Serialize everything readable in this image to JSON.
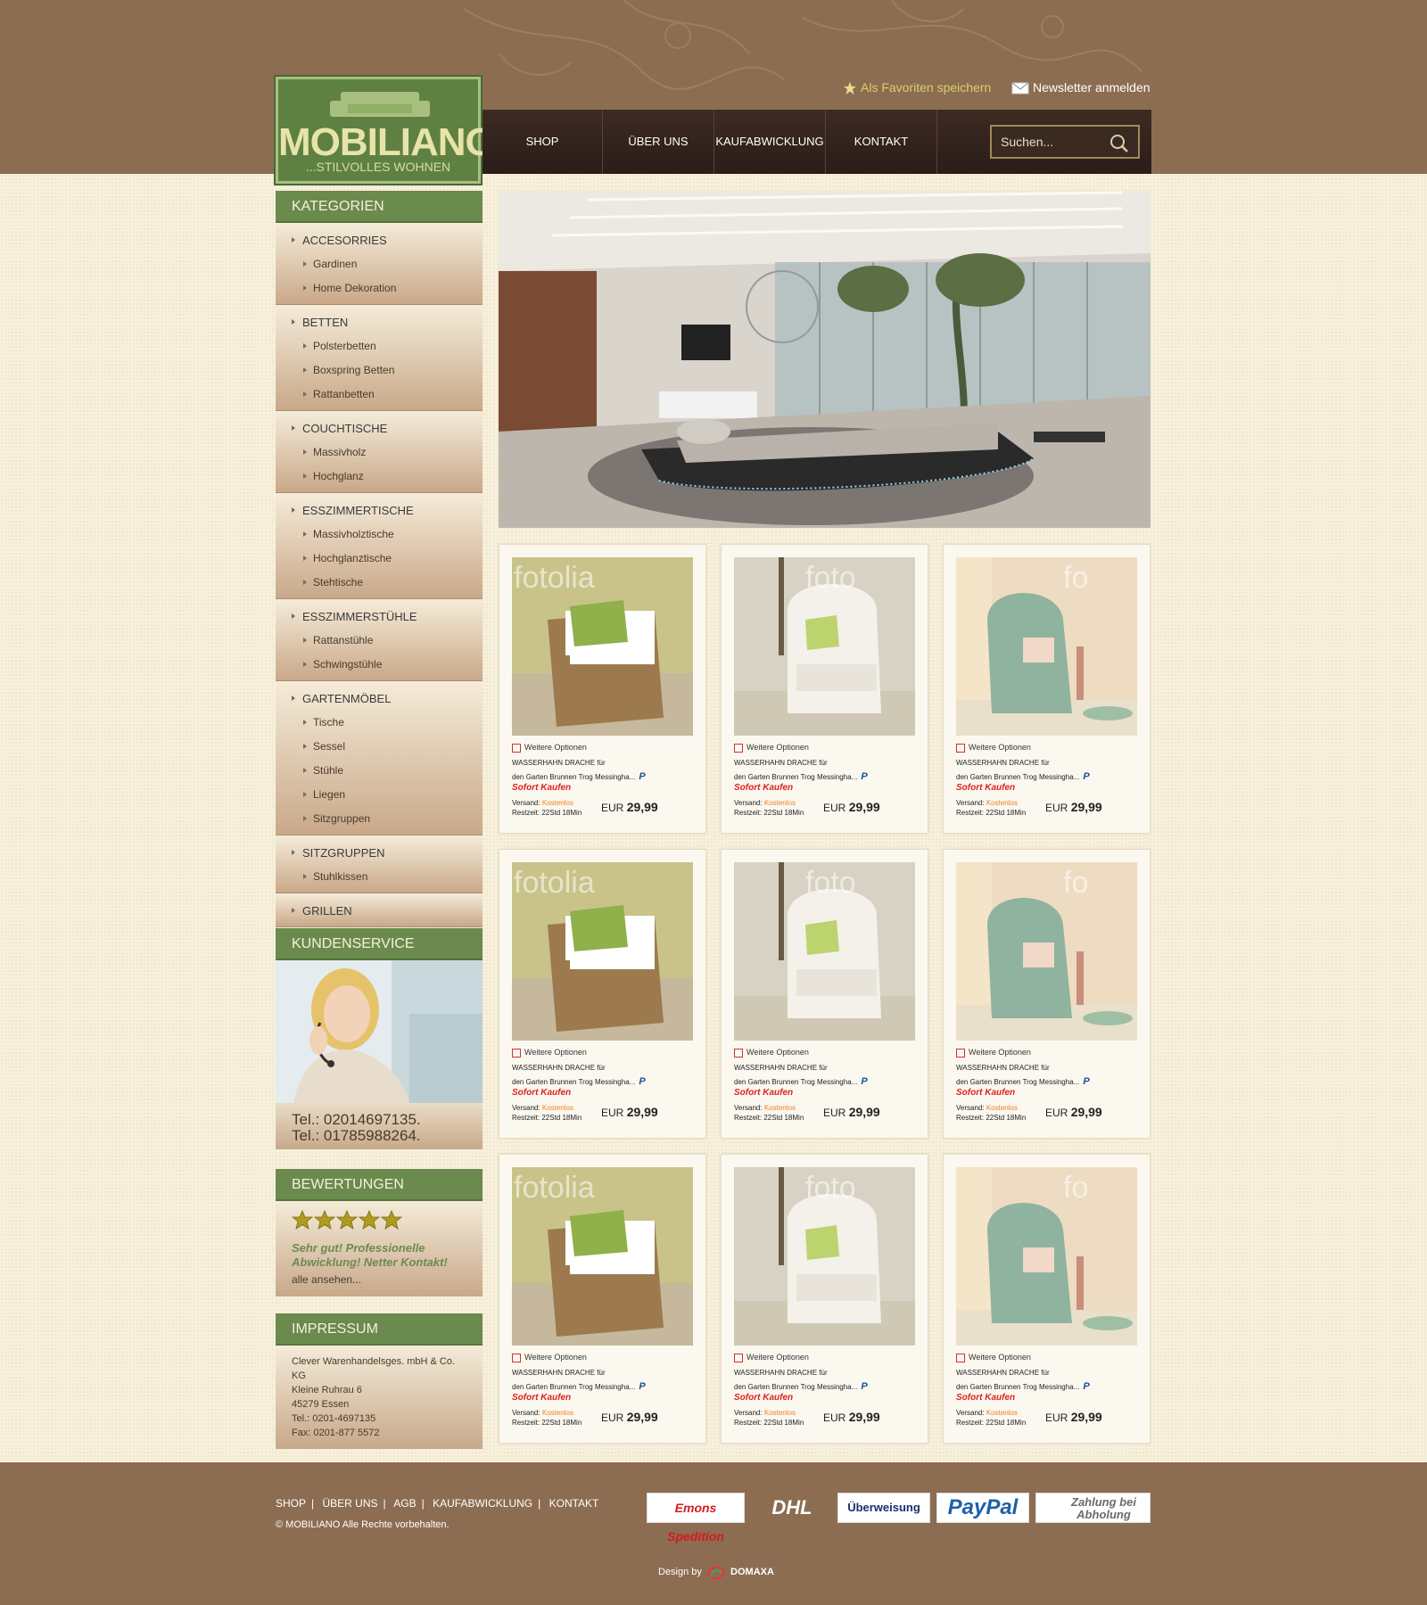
{
  "header": {
    "logo_brand": "MOBILIANO",
    "logo_tagline": "...STILVOLLES WOHNEN",
    "fav_link": "Als Favoriten speichern",
    "newsletter_link": "Newsletter anmelden",
    "search_placeholder": "Suchen..."
  },
  "nav": [
    "SHOP",
    "ÜBER UNS",
    "KAUFABWICKLUNG",
    "KONTAKT"
  ],
  "categories": {
    "title": "KATEGORIEN",
    "groups": [
      {
        "label": "ACCESORRIES",
        "subs": [
          "Gardinen",
          "Home Dekoration"
        ]
      },
      {
        "label": "BETTEN",
        "subs": [
          "Polsterbetten",
          "Boxspring Betten",
          "Rattanbetten"
        ]
      },
      {
        "label": "COUCHTISCHE",
        "subs": [
          "Massivholz",
          "Hochglanz"
        ]
      },
      {
        "label": "ESSZIMMERTISCHE",
        "subs": [
          "Massivholztische",
          "Hochglanztische",
          "Stehtische"
        ]
      },
      {
        "label": "ESSZIMMERSTÜHLE",
        "subs": [
          "Rattanstühle",
          "Schwingstühle"
        ]
      },
      {
        "label": "GARTENMÖBEL",
        "subs": [
          "Tische",
          "Sessel",
          "Stühle",
          "Liegen",
          "Sitzgruppen"
        ]
      },
      {
        "label": "SITZGRUPPEN",
        "subs": [
          "Stuhlkissen"
        ]
      },
      {
        "label": "GRILLEN",
        "subs": []
      }
    ]
  },
  "kundenservice": {
    "title": "KUNDENSERVICE",
    "tel1": "Tel.: 02014697135.",
    "tel2": "Tel.: 01785988264."
  },
  "bewertungen": {
    "title": "BEWERTUNGEN",
    "stars": 5,
    "quote": "Sehr gut! Professionelle Abwicklung! Netter Kontakt!",
    "more": "alle ansehen..."
  },
  "impressum": {
    "title": "IMPRESSUM",
    "company": "Clever Warenhandelsges. mbH & Co. KG",
    "street": "Kleine Ruhrau 6",
    "city": "45279 Essen",
    "tel": "Tel.: 0201-4697135",
    "fax": "Fax: 0201-877 5572"
  },
  "product": {
    "options": "Weitere Optionen",
    "title_line1": "WASSERHAHN DRACHE für",
    "title_line2": "den Garten Brunnen Trog Messingha...",
    "paypal": "P",
    "sofort": "Sofort Kaufen",
    "versand_label": "Versand:",
    "versand_value": "Kostenlos",
    "restzeit": "Restzeit: 22Std 18Min",
    "price_currency": "EUR",
    "price": "29,99",
    "watermarks": [
      "fotolia",
      "foto",
      "fo"
    ]
  },
  "footer": {
    "links": [
      "SHOP",
      "ÜBER UNS",
      "AGB",
      "KAUFABWICKLUNG",
      "KONTAKT"
    ],
    "copyright": "© MOBILIANO     Alle Rechte vorbehalten.",
    "payments": [
      "Emons Spedition",
      "DHL",
      "Überweisung",
      "PayPal",
      "Zahlung bei Abholung"
    ],
    "design_by": "Design by",
    "designer": "DOMAXA"
  }
}
